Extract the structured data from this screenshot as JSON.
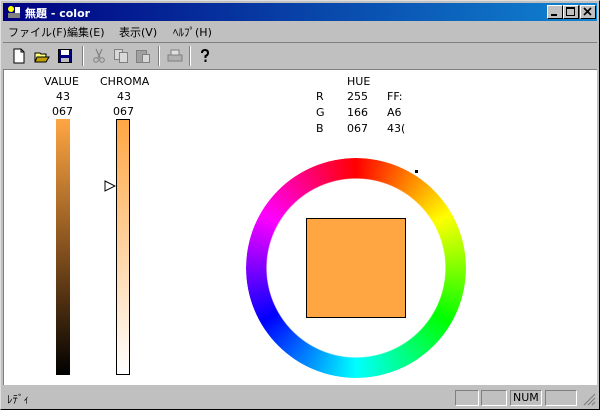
{
  "window": {
    "title": "無題 - color"
  },
  "menu": {
    "items": [
      "ファイル(F)",
      "編集(E)",
      "表示(V)",
      "ﾍﾙﾌﾟ(H)"
    ]
  },
  "toolbar": {
    "buttons": [
      "new-icon",
      "open-icon",
      "save-icon",
      "cut-icon",
      "copy-icon",
      "paste-icon",
      "print-icon",
      "help-icon"
    ]
  },
  "value_panel": {
    "label": "VALUE",
    "number": "43",
    "code": "067"
  },
  "chroma_panel": {
    "label": "CHROMA",
    "number": "43",
    "code": "067",
    "marker_level": 0.74
  },
  "hue_panel": {
    "label": "HUE",
    "rows": [
      {
        "channel": "R",
        "dec": "255",
        "hex": "FF:"
      },
      {
        "channel": "G",
        "dec": "166",
        "hex": "A6"
      },
      {
        "channel": "B",
        "dec": "067",
        "hex": "43("
      }
    ]
  },
  "colors": {
    "current": "#FFA643",
    "titlebar": "#000080"
  },
  "status": {
    "text": "ﾚﾃﾞｨ",
    "num": "NUM"
  }
}
